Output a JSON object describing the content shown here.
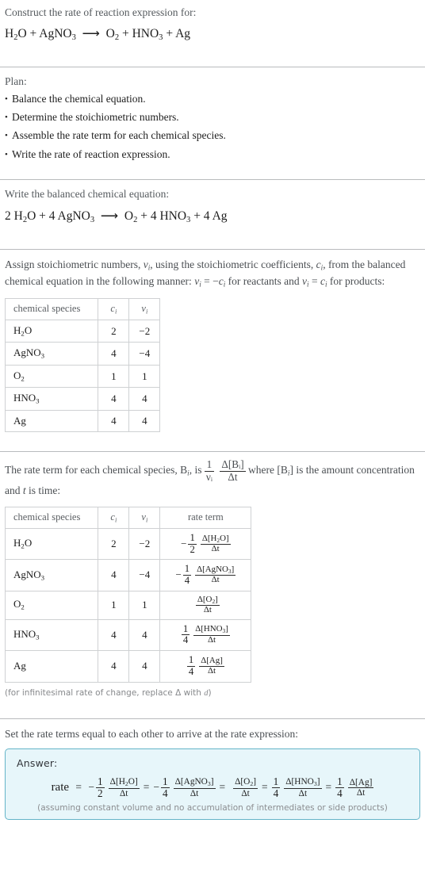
{
  "header": {
    "prompt": "Construct the rate of reaction expression for:",
    "equation_html": "H<sub>2</sub>O + AgNO<sub>3</sub>&nbsp; &#10230;&nbsp; O<sub>2</sub> + HNO<sub>3</sub> + Ag"
  },
  "plan": {
    "title": "Plan:",
    "steps": [
      "Balance the chemical equation.",
      "Determine the stoichiometric numbers.",
      "Assemble the rate term for each chemical species.",
      "Write the rate of reaction expression."
    ]
  },
  "balanced": {
    "title": "Write the balanced chemical equation:",
    "equation_html": "2 H<sub>2</sub>O + 4 AgNO<sub>3</sub>&nbsp; &#10230;&nbsp; O<sub>2</sub> + 4 HNO<sub>3</sub> + 4 Ag"
  },
  "stoich": {
    "paragraph_html": "Assign stoichiometric numbers, <i>&nu;<sub>i</sub></i>, using the stoichiometric coefficients, <i>c<sub>i</sub></i>, from the balanced chemical equation in the following manner: <i>&nu;<sub>i</sub></i> = &minus;<i>c<sub>i</sub></i> for reactants and <i>&nu;<sub>i</sub></i> = <i>c<sub>i</sub></i> for products:",
    "table": {
      "headers": [
        "chemical species",
        "c_i",
        "ν_i"
      ],
      "rows": [
        {
          "species_html": "H<sub>2</sub>O",
          "c": "2",
          "v": "−2"
        },
        {
          "species_html": "AgNO<sub>3</sub>",
          "c": "4",
          "v": "−4"
        },
        {
          "species_html": "O<sub>2</sub>",
          "c": "1",
          "v": "1"
        },
        {
          "species_html": "HNO<sub>3</sub>",
          "c": "4",
          "v": "4"
        },
        {
          "species_html": "Ag",
          "c": "4",
          "v": "4"
        }
      ]
    }
  },
  "rateterm": {
    "paragraph_pre": "The rate term for each chemical species, B",
    "paragraph_html": "The rate term for each chemical species, B<sub><i>i</i></sub>, is",
    "paragraph_post_html": "where [B<sub><i>i</i></sub>] is the amount concentration and <i>t</i> is time:",
    "formula": {
      "num1": "1",
      "den1": "νᵢ",
      "num2": "Δ[Bᵢ]",
      "den2": "Δt"
    },
    "table": {
      "headers": [
        "chemical species",
        "c_i",
        "ν_i",
        "rate term"
      ],
      "rows": [
        {
          "species_html": "H<sub>2</sub>O",
          "c": "2",
          "v": "−2",
          "sign": "−",
          "coef_num": "1",
          "coef_den": "2",
          "delta_html": "Δ[H<sub>2</sub>O]",
          "dt": "Δt"
        },
        {
          "species_html": "AgNO<sub>3</sub>",
          "c": "4",
          "v": "−4",
          "sign": "−",
          "coef_num": "1",
          "coef_den": "4",
          "delta_html": "Δ[AgNO<sub>3</sub>]",
          "dt": "Δt"
        },
        {
          "species_html": "O<sub>2</sub>",
          "c": "1",
          "v": "1",
          "sign": "",
          "coef_num": "",
          "coef_den": "",
          "delta_html": "Δ[O<sub>2</sub>]",
          "dt": "Δt"
        },
        {
          "species_html": "HNO<sub>3</sub>",
          "c": "4",
          "v": "4",
          "sign": "",
          "coef_num": "1",
          "coef_den": "4",
          "delta_html": "Δ[HNO<sub>3</sub>]",
          "dt": "Δt"
        },
        {
          "species_html": "Ag",
          "c": "4",
          "v": "4",
          "sign": "",
          "coef_num": "1",
          "coef_den": "4",
          "delta_html": "Δ[Ag]",
          "dt": "Δt"
        }
      ]
    },
    "footnote_html": "(for infinitesimal rate of change, replace Δ with <i>d</i>)"
  },
  "final": {
    "title": "Set the rate terms equal to each other to arrive at the rate expression:",
    "answer_label": "Answer:",
    "rate_label": "rate",
    "terms": [
      {
        "sign": "−",
        "coef_num": "1",
        "coef_den": "2",
        "delta_html": "Δ[H<sub>2</sub>O]",
        "dt": "Δt"
      },
      {
        "sign": "−",
        "coef_num": "1",
        "coef_den": "4",
        "delta_html": "Δ[AgNO<sub>3</sub>]",
        "dt": "Δt"
      },
      {
        "sign": "",
        "coef_num": "",
        "coef_den": "",
        "delta_html": "Δ[O<sub>2</sub>]",
        "dt": "Δt"
      },
      {
        "sign": "",
        "coef_num": "1",
        "coef_den": "4",
        "delta_html": "Δ[HNO<sub>3</sub>]",
        "dt": "Δt"
      },
      {
        "sign": "",
        "coef_num": "1",
        "coef_den": "4",
        "delta_html": "Δ[Ag]",
        "dt": "Δt"
      }
    ],
    "note": "(assuming constant volume and no accumulation of intermediates or side products)"
  },
  "colors": {
    "answer_border": "#64b4c8",
    "answer_bg": "#e7f6fa",
    "rule": "#b9bbbd",
    "table_border": "#cfd1d3",
    "muted_text": "#555a5e",
    "body_text": "#1d1d1d"
  }
}
